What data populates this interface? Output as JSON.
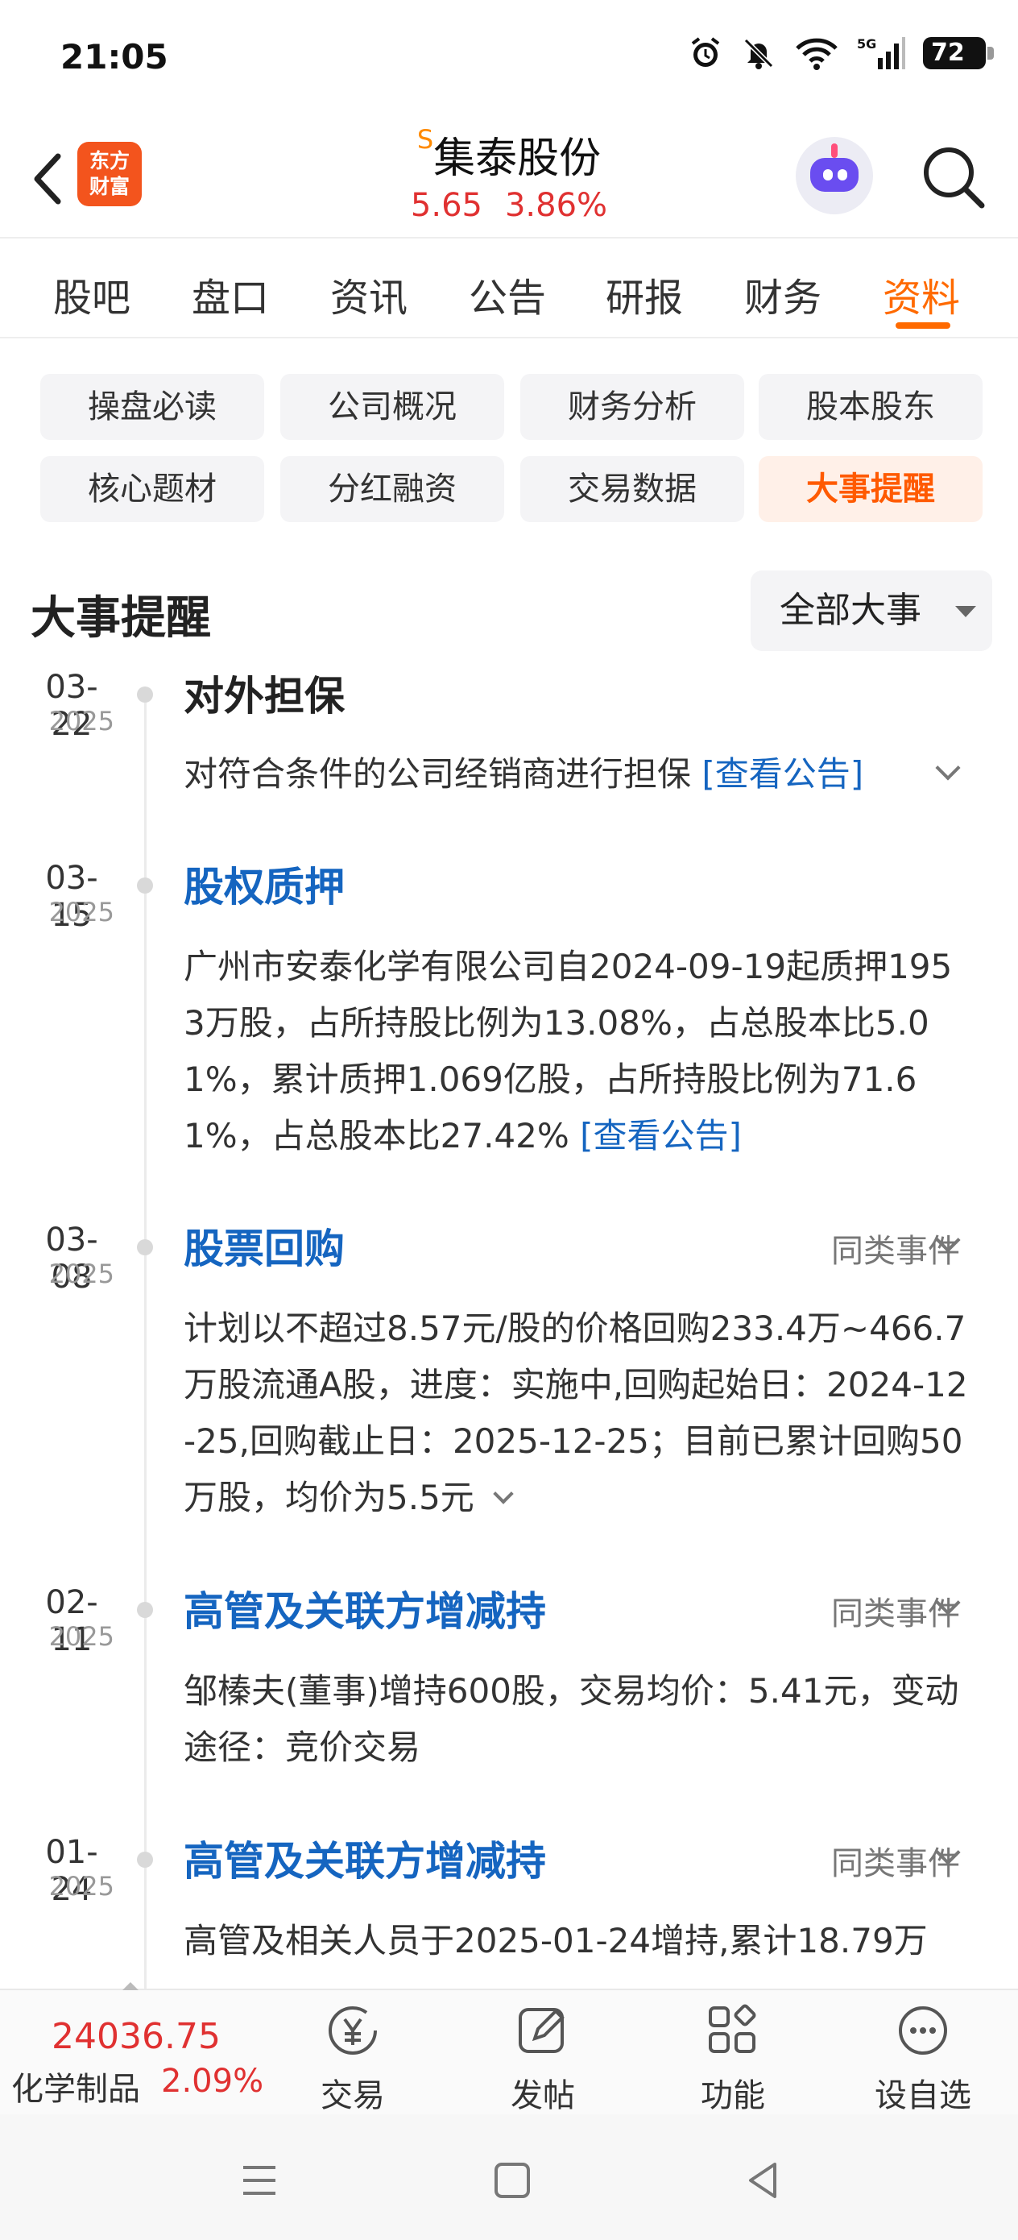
{
  "status_bar": {
    "time": "21:05",
    "battery": "72",
    "network": "5G"
  },
  "header": {
    "logo_text": [
      "东方",
      "财富"
    ],
    "s_mark": "S",
    "stock_name": "集泰股份",
    "price": "5.65",
    "change_pct": "3.86%"
  },
  "tabs": [
    "股吧",
    "盘口",
    "资讯",
    "公告",
    "研报",
    "财务",
    "资料"
  ],
  "active_tab": "资料",
  "chips": [
    "操盘必读",
    "公司概况",
    "财务分析",
    "股本股东",
    "核心题材",
    "分红融资",
    "交易数据",
    "大事提醒"
  ],
  "active_chip": "大事提醒",
  "section": {
    "title": "大事提醒",
    "filter": "全部大事"
  },
  "events": [
    {
      "date": "03-22",
      "year": "2025",
      "title": "对外担保",
      "body": "对符合条件的公司经销商进行担保",
      "link": "[查看公告]"
    },
    {
      "date": "03-15",
      "year": "2025",
      "title": "股权质押",
      "body": "广州市安泰化学有限公司自2024-09-19起质押1953万股，占所持股比例为13.08%，占总股本比5.01%，累计质押1.069亿股，占所持股比例为71.61%，占总股本比27.42%",
      "link": "[查看公告]"
    },
    {
      "date": "03-08",
      "year": "2025",
      "title": "股票回购",
      "similar": "同类事件",
      "body": "计划以不超过8.57元/股的价格回购233.4万~466.7万股流通A股，进度：实施中,回购起始日：2024-12-25,回购截止日：2025-12-25；目前已累计回购50万股，均价为5.5元"
    },
    {
      "date": "02-11",
      "year": "2025",
      "title": "高管及关联方增减持",
      "similar": "同类事件",
      "body": "邹榛夫(董事)增持600股，交易均价：5.41元，变动途径：竞价交易"
    },
    {
      "date": "01-24",
      "year": "2025",
      "title": "高管及关联方增减持",
      "similar": "同类事件",
      "body": "高管及相关人员于2025-01-24增持,累计18.79万"
    }
  ],
  "bottom_bar": {
    "index_value": "24036.75",
    "index_name": "化学制品",
    "index_pct": "2.09%",
    "items": [
      {
        "label": "交易",
        "icon": "yen-trade-icon"
      },
      {
        "label": "发帖",
        "icon": "edit-post-icon"
      },
      {
        "label": "功能",
        "icon": "grid-function-icon"
      },
      {
        "label": "设自选",
        "icon": "more-dots-icon"
      }
    ]
  },
  "colors": {
    "accent": "#ff6a00",
    "up_red": "#e03131",
    "link_blue": "#1565c0"
  }
}
